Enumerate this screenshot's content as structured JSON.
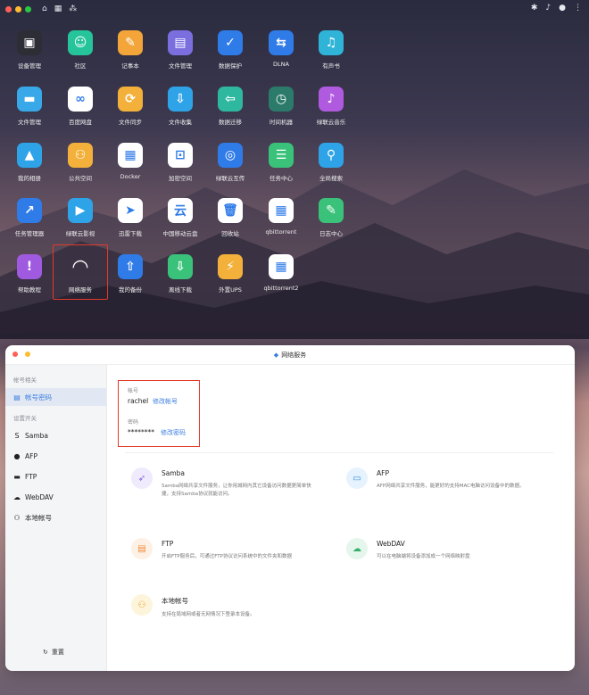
{
  "desktop": {
    "apps": [
      {
        "label": "设备管理",
        "icon": "device-icon",
        "color": "#2d2d35"
      },
      {
        "label": "社区",
        "icon": "community-icon",
        "color": "#26c49a"
      },
      {
        "label": "记事本",
        "icon": "notepad-icon",
        "color": "#f3a53a"
      },
      {
        "label": "文件管理",
        "icon": "file-manager-icon",
        "color": "#7b6fe0"
      },
      {
        "label": "数据保护",
        "icon": "shield-icon",
        "color": "#2f7be8"
      },
      {
        "label": "DLNA",
        "icon": "dlna-icon",
        "color": "#2f7be8"
      },
      {
        "label": "有声书",
        "icon": "audiobook-icon",
        "color": "#2fb4d8"
      },
      {
        "label": "文件管理",
        "icon": "folder-icon",
        "color": "#38a8e8"
      },
      {
        "label": "百度网盘",
        "icon": "baidu-icon",
        "color": "#ffffff"
      },
      {
        "label": "文件同步",
        "icon": "sync-icon",
        "color": "#f3b03a"
      },
      {
        "label": "文件收集",
        "icon": "collect-icon",
        "color": "#2fa3e8"
      },
      {
        "label": "数据迁移",
        "icon": "migrate-icon",
        "color": "#2fb8a0"
      },
      {
        "label": "时间机器",
        "icon": "time-machine-icon",
        "color": "#2b7a6a"
      },
      {
        "label": "绿联云音乐",
        "icon": "music-icon",
        "color": "#b05ae0"
      },
      {
        "label": "我的相册",
        "icon": "photo-icon",
        "color": "#2fa3e8"
      },
      {
        "label": "公共空间",
        "icon": "public-space-icon",
        "color": "#f3b03a"
      },
      {
        "label": "Docker",
        "icon": "docker-icon",
        "color": "#ffffff"
      },
      {
        "label": "加密空间",
        "icon": "encrypt-icon",
        "color": "#ffffff"
      },
      {
        "label": "绿联云互传",
        "icon": "transfer-icon",
        "color": "#2f7be8"
      },
      {
        "label": "任务中心",
        "icon": "task-icon",
        "color": "#3ac27a"
      },
      {
        "label": "全局搜索",
        "icon": "search-icon",
        "color": "#2fa3e8"
      },
      {
        "label": "任务管理器",
        "icon": "task-manager-icon",
        "color": "#2f7be8"
      },
      {
        "label": "绿联云影视",
        "icon": "video-icon",
        "color": "#2fa3e8"
      },
      {
        "label": "迅雷下载",
        "icon": "thunder-icon",
        "color": "#ffffff"
      },
      {
        "label": "中国移动云盘",
        "icon": "cloud-icon",
        "color": "#ffffff"
      },
      {
        "label": "回收站",
        "icon": "trash-icon",
        "color": "#ffffff"
      },
      {
        "label": "qbittorrent",
        "icon": "qbittorrent-icon",
        "color": "#ffffff"
      },
      {
        "label": "日志中心",
        "icon": "log-icon",
        "color": "#3ac27a"
      },
      {
        "label": "帮助教程",
        "icon": "help-icon",
        "color": "#a05ae0"
      },
      {
        "label": "网络服务",
        "icon": "wifi-icon",
        "color": "transparent"
      },
      {
        "label": "我的备份",
        "icon": "backup-icon",
        "color": "#2f7be8"
      },
      {
        "label": "离线下载",
        "icon": "download-icon",
        "color": "#3ac27a"
      },
      {
        "label": "外置UPS",
        "icon": "ups-icon",
        "color": "#f3b03a"
      },
      {
        "label": "qbittorrent2",
        "icon": "qbittorrent-icon",
        "color": "#ffffff"
      }
    ]
  },
  "window": {
    "title": "网络服务",
    "sidebar": {
      "section1": "帐号相关",
      "account_item": "帐号密码",
      "section2": "设置开关",
      "items": [
        "Samba",
        "AFP",
        "FTP",
        "WebDAV",
        "本地帐号"
      ],
      "reset": "重置"
    },
    "account": {
      "account_label": "帐号",
      "account_value": "rachel",
      "change_account": "修改帐号",
      "password_label": "密码",
      "password_value": "********",
      "change_password": "修改密码"
    },
    "services": [
      {
        "name": "Samba",
        "desc": "Samba网络共享文件服务，让你用城网内其它设备访问数据更简单快捷，支持Samba协议就能访问。"
      },
      {
        "name": "AFP",
        "desc": "AFP网络共享文件服务，能更好的支持MAC电脑访问设备中的数据。"
      },
      {
        "name": "FTP",
        "desc": "开启FTP服务后，可通过FTP协议访问系统中的文件夹和数据"
      },
      {
        "name": "WebDAV",
        "desc": "可以在电脑端将设备添加成一个网络映射盘"
      },
      {
        "name": "本地帐号",
        "desc": "支持在局域网或者无网情况下登录本设备。"
      }
    ]
  }
}
